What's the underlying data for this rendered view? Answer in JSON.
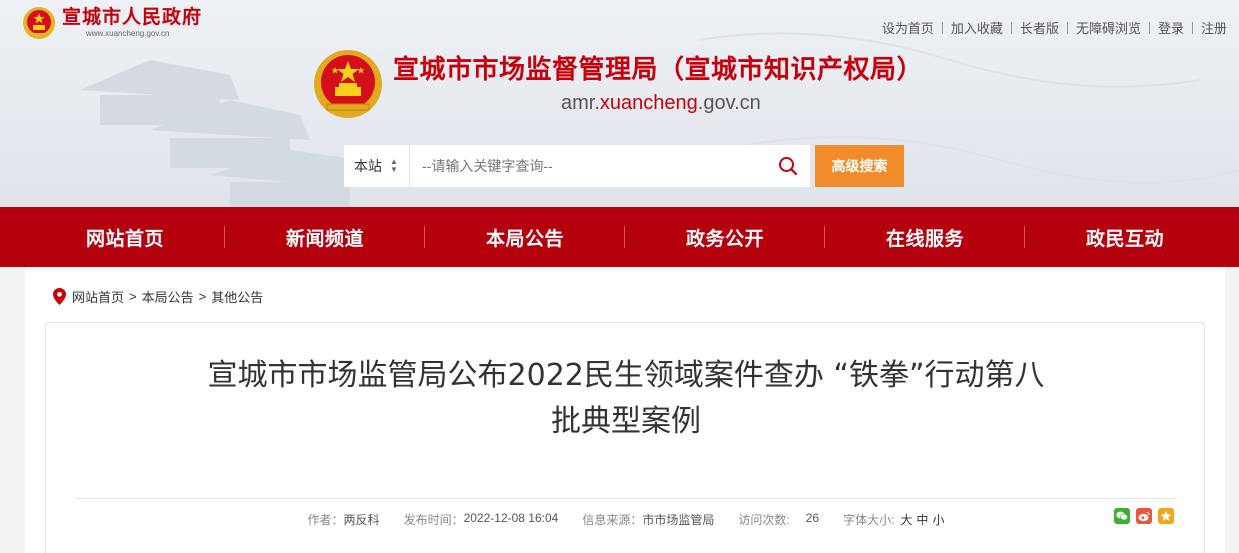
{
  "colors": {
    "brand_red": "#c7000b",
    "nav_red": "#b5000e",
    "orange": "#f28b29"
  },
  "header": {
    "gov_title": "宣城市人民政府",
    "gov_url": "www.xuancheng.gov.cn",
    "site_title": "宣城市市场监督管理局（宣城市知识产权局）",
    "site_url_prefix": "amr.",
    "site_url_mid": "xuancheng",
    "site_url_suffix": ".gov.cn",
    "top_links": [
      "设为首页",
      "加入收藏",
      "长者版",
      "无障碍浏览",
      "登录",
      "注册"
    ]
  },
  "search": {
    "scope": "本站",
    "placeholder": "--请输入关键字查询--",
    "advanced_label": "高级搜索"
  },
  "nav": {
    "items": [
      "网站首页",
      "新闻频道",
      "本局公告",
      "政务公开",
      "在线服务",
      "政民互动"
    ]
  },
  "breadcrumb": {
    "items": [
      "网站首页",
      "本局公告",
      "其他公告"
    ],
    "separator": ">"
  },
  "article": {
    "title_line1": "宣城市市场监管局公布2022民生领域案件查办 “铁拳”行动第八",
    "title_line2": "批典型案例",
    "author_label": "作者：",
    "author": "两反科",
    "date_label": "发布时间：",
    "date": "2022-12-08 16:04",
    "source_label": "信息来源：",
    "source": "市市场监管局",
    "visits_label": "访问次数:",
    "visits": "26",
    "font_label": "字体大小:",
    "font_large": "大",
    "font_medium": "中",
    "font_small": "小",
    "share_icons": [
      "wechat-icon",
      "weibo-icon",
      "favorite-icon"
    ]
  }
}
